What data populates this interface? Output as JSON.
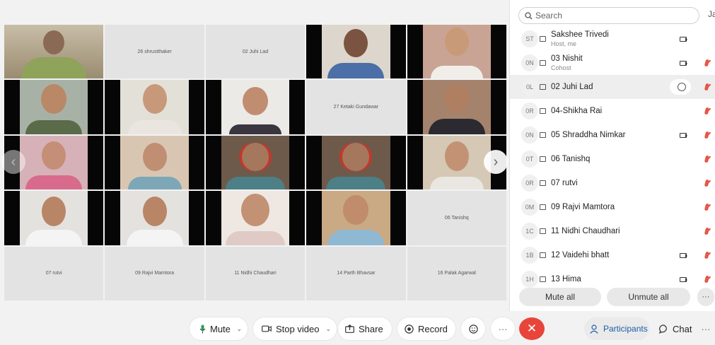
{
  "search": {
    "placeholder": "Search",
    "cut_label": "Ja"
  },
  "grid": {
    "empty_tiles": [
      "26 shrustthaker",
      "02 Juhi Lad",
      "27 Ketaki Gundawar",
      "06 Tanishq",
      "07 rutvi",
      "09 Rajvi Mamtora",
      "11 Nidhi Chaudhari",
      "14 Parth Bhavsar",
      "16 Palak Agarwal"
    ]
  },
  "participants": [
    {
      "initials": "ST",
      "name": "Sakshee Trivedi",
      "sub": "Host, me",
      "camera": true,
      "muted": false
    },
    {
      "initials": "0N",
      "name": "03  Nishit",
      "sub": "Cohost",
      "camera": true,
      "muted": true
    },
    {
      "initials": "0L",
      "name": "02 Juhi Lad",
      "sub": "",
      "camera": false,
      "muted": true,
      "chat": true
    },
    {
      "initials": "0R",
      "name": "04-Shikha Rai",
      "sub": "",
      "camera": false,
      "muted": true
    },
    {
      "initials": "0N",
      "name": "05 Shraddha Nimkar",
      "sub": "",
      "camera": true,
      "muted": true
    },
    {
      "initials": "0T",
      "name": "06 Tanishq",
      "sub": "",
      "camera": false,
      "muted": true
    },
    {
      "initials": "0R",
      "name": "07 rutvi",
      "sub": "",
      "camera": false,
      "muted": true
    },
    {
      "initials": "0M",
      "name": "09 Rajvi Mamtora",
      "sub": "",
      "camera": false,
      "muted": true
    },
    {
      "initials": "1C",
      "name": "11 Nidhi Chaudhari",
      "sub": "",
      "camera": false,
      "muted": true
    },
    {
      "initials": "1B",
      "name": "12 Vaidehi bhatt",
      "sub": "",
      "camera": true,
      "muted": true
    },
    {
      "initials": "1H",
      "name": "13 Hima",
      "sub": "",
      "camera": true,
      "muted": true
    }
  ],
  "panel_buttons": {
    "mute_all": "Mute all",
    "unmute_all": "Unmute all",
    "more": "···"
  },
  "controls": {
    "mute": "Mute",
    "stop_video": "Stop video",
    "share": "Share",
    "record": "Record",
    "more": "···",
    "participants": "Participants",
    "chat": "Chat",
    "overflow": "···"
  },
  "colors": {
    "end_call": "#e8453a",
    "accent": "#1a5ea8",
    "muted_mic": "#e6564a"
  }
}
